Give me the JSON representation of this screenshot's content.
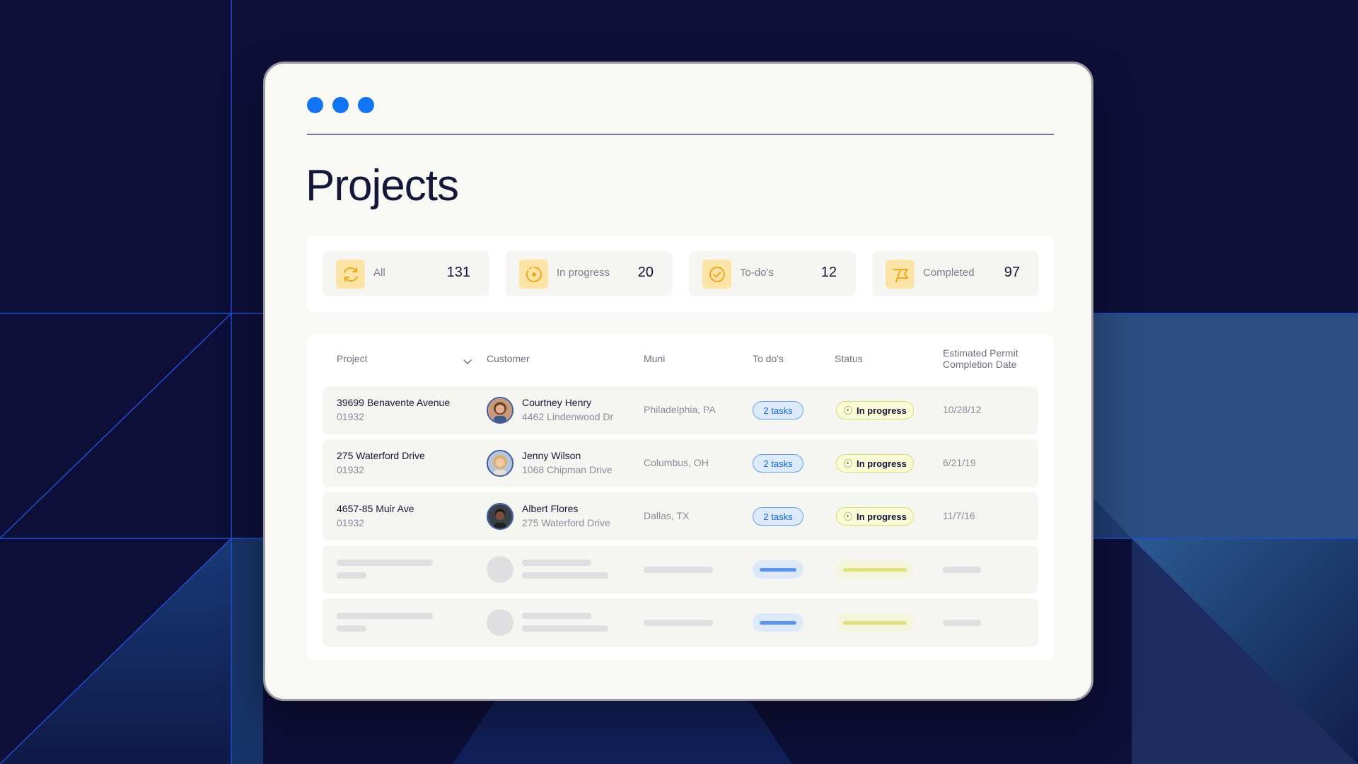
{
  "page": {
    "title": "Projects"
  },
  "stats": [
    {
      "label": "All",
      "value": "131",
      "icon": "refresh-icon"
    },
    {
      "label": "In progress",
      "value": "20",
      "icon": "progress-icon"
    },
    {
      "label": "To-do's",
      "value": "12",
      "icon": "check-circle-icon"
    },
    {
      "label": "Completed",
      "value": "97",
      "icon": "flag-icon"
    }
  ],
  "table": {
    "headers": {
      "project": "Project",
      "customer": "Customer",
      "muni": "Muni",
      "todos": "To do's",
      "status": "Status",
      "permit_line1": "Estimated Permit",
      "permit_line2": "Completion Date"
    },
    "rows": [
      {
        "project": "39699 Benavente Avenue",
        "project_id": "01932",
        "customer_name": "Courtney Henry",
        "customer_address": "4462 Lindenwood Dr",
        "muni": "Philadelphia, PA",
        "todos": "2 tasks",
        "status": "In progress",
        "date": "10/28/12"
      },
      {
        "project": "275 Waterford Drive",
        "project_id": "01932",
        "customer_name": "Jenny Wilson",
        "customer_address": "1068 Chipman Drive",
        "muni": "Columbus, OH",
        "todos": "2 tasks",
        "status": "In progress",
        "date": "6/21/19"
      },
      {
        "project": "4657-85 Muir Ave",
        "project_id": "01932",
        "customer_name": "Albert Flores",
        "customer_address": "275 Waterford Drive",
        "muni": "Dallas, TX",
        "todos": "2 tasks",
        "status": "In progress",
        "date": "11/7/16"
      }
    ]
  },
  "colors": {
    "accent": "#1273f5",
    "background": "#0e0f38",
    "icon_bg": "#fbe4a6",
    "icon_fg": "#f0a81a"
  }
}
